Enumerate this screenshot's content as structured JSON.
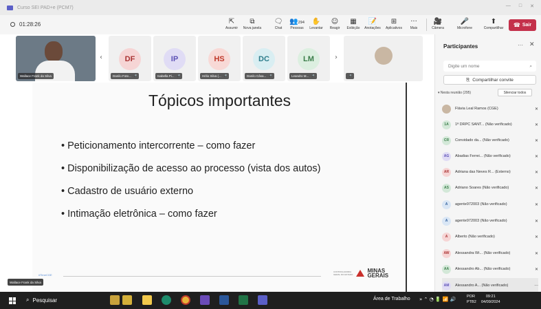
{
  "window": {
    "title": "Curso SEI PAD+e (PCM7)",
    "controls": [
      "—",
      "□",
      "✕"
    ]
  },
  "toolbar": {
    "timer": "01:28:26",
    "buttons": [
      {
        "label": "Assumir",
        "icon": "⇱"
      },
      {
        "label": "Nova janela",
        "icon": "⧉"
      },
      {
        "label": "Chat",
        "icon": "🗨"
      },
      {
        "label": "Pessoas",
        "icon": "👥",
        "count": "294"
      },
      {
        "label": "Levantar",
        "icon": "✋"
      },
      {
        "label": "Reagir",
        "icon": "☺"
      },
      {
        "label": "Exibição",
        "icon": "▦"
      },
      {
        "label": "Anotações",
        "icon": "📝"
      },
      {
        "label": "Aplicativos",
        "icon": "⊞"
      },
      {
        "label": "Mais",
        "icon": "···"
      },
      {
        "label": "Câmera",
        "icon": "🎥"
      },
      {
        "label": "Microfone",
        "icon": "🎤"
      },
      {
        "label": "Compartilhar",
        "icon": "⬆"
      }
    ],
    "leave_label": "Sair"
  },
  "video_strip": {
    "main_name": "Wallace Frank da Silva",
    "tiles": [
      {
        "initials": "DF",
        "name": "Danilo Fote...",
        "color": "#f6d5d5",
        "text": "#a33"
      },
      {
        "initials": "IP",
        "name": "Isabella Pi...",
        "color": "#e0dcf5",
        "text": "#5b4fb5"
      },
      {
        "initials": "HS",
        "name": "Hélio Silva (...",
        "color": "#f8d9d6",
        "text": "#c0392b"
      },
      {
        "initials": "DC",
        "name": "Danilo Câsa...",
        "color": "#d9eef2",
        "text": "#2e7d8c"
      },
      {
        "initials": "LM",
        "name": "Leandro M...",
        "color": "#dcefe0",
        "text": "#3b7d4a"
      }
    ],
    "last_tile_mic": "🎤"
  },
  "slide": {
    "title": "Tópicos importantes",
    "bullets": [
      "• Peticionamento intercorrente – como fazer",
      "• Disponibilização de acesso ao processo (vista dos autos)",
      "• Cadastro de usuário externo",
      "• Intimação eletrônica – como fazer"
    ],
    "hashtag": "#TimeCGE",
    "logo_text": "MINAS GERAIS",
    "logo_small": "CONTROLADORIA GERAL DO ESTADO"
  },
  "presenter_tag": "Wallace Frank da Silva",
  "panel": {
    "title": "Participantes",
    "more": "···",
    "close": "✕",
    "search_placeholder": "Digite um nome",
    "invite_label": "Compartilhar convite",
    "in_meeting": "▾ Nesta reunião (295)",
    "mute_all": "Silenciar todos",
    "participants": [
      {
        "initials": "",
        "name": "Flávia Leal Ramos (CGE)",
        "color": "#c9b7a3",
        "text": "#fff"
      },
      {
        "initials": "1A",
        "name": "1ª DRPC SANT... (Não verificado)",
        "color": "#d3e8d8",
        "text": "#3b7d4a"
      },
      {
        "initials": "CR",
        "name": "Convidado da... (Não verificado)",
        "color": "#d3e8d8",
        "text": "#3b7d4a"
      },
      {
        "initials": "AG",
        "name": "Abadias Ferrei... (Não verificado)",
        "color": "#e0dcf5",
        "text": "#5b4fb5"
      },
      {
        "initials": "AR",
        "name": "Adriana das Neves R... (Externo)",
        "color": "#f6d5d5",
        "text": "#a33"
      },
      {
        "initials": "AS",
        "name": "Adriano Soares (Não verificado)",
        "color": "#d3e8d8",
        "text": "#3b7d4a"
      },
      {
        "initials": "A",
        "name": "agente972003 (Não verificado)",
        "color": "#d9e6f5",
        "text": "#2f5f9c"
      },
      {
        "initials": "A",
        "name": "agente972003 (Não verificado)",
        "color": "#d9e6f5",
        "text": "#2f5f9c"
      },
      {
        "initials": "A",
        "name": "Alberto (Não verificado)",
        "color": "#f6d5d5",
        "text": "#a33"
      },
      {
        "initials": "AW",
        "name": "Alessandra Wi... (Não verificado)",
        "color": "#f6d5d5",
        "text": "#a33"
      },
      {
        "initials": "AA",
        "name": "Alessandro Ab... (Não verificado)",
        "color": "#d3e8d8",
        "text": "#3b7d4a"
      },
      {
        "initials": "AM",
        "name": "Alessandro A... (Não verificado)",
        "color": "#e0dcf5",
        "text": "#5b4fb5"
      }
    ]
  },
  "taskbar": {
    "search_label": "Pesquisar",
    "work_area": "Área de Trabalho",
    "lang_1": "POR",
    "lang_2": "PTB2",
    "time": "09:21",
    "date": "04/09/2024"
  }
}
